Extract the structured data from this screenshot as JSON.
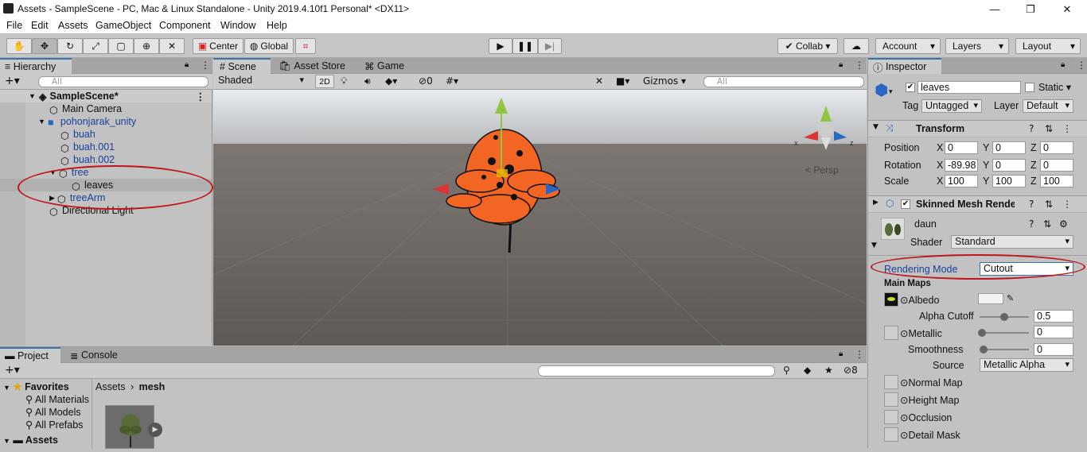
{
  "titlebar": {
    "title": "Assets - SampleScene - PC, Mac & Linux Standalone - Unity 2019.4.10f1 Personal* <DX11>",
    "minimize": "—",
    "maximize": "❐",
    "close": "✕"
  },
  "menu": [
    "File",
    "Edit",
    "Assets",
    "GameObject",
    "Component",
    "Window",
    "Help"
  ],
  "toolbar": {
    "center": "Center",
    "global": "Global",
    "collab": "Collab",
    "account": "Account",
    "layers": "Layers",
    "layout": "Layout"
  },
  "hierarchy": {
    "tab": "Hierarchy",
    "search_placeholder": "All",
    "scene": "SampleScene*",
    "items": [
      {
        "label": "Main Camera",
        "blue": false
      },
      {
        "label": "pohonjarak_unity",
        "blue": true
      },
      {
        "label": "buah",
        "blue": true
      },
      {
        "label": "buah.001",
        "blue": true
      },
      {
        "label": "buah.002",
        "blue": true
      },
      {
        "label": "tree",
        "blue": true
      },
      {
        "label": "leaves",
        "blue": false
      },
      {
        "label": "treeArm",
        "blue": true
      },
      {
        "label": "Directional Light",
        "blue": false
      }
    ]
  },
  "scene": {
    "tabs": [
      "Scene",
      "Asset Store",
      "Game"
    ],
    "shading": "Shaded",
    "mode2d": "2D",
    "fx_count": "0",
    "gizmos": "Gizmos",
    "search_placeholder": "All",
    "persp": "< Persp",
    "axis_x": "x",
    "axis_z": "z"
  },
  "project": {
    "tabs": [
      "Project",
      "Console"
    ],
    "favorites": "Favorites",
    "fav_items": [
      "All Materials",
      "All Models",
      "All Prefabs"
    ],
    "assets": "Assets",
    "breadcrumb": [
      "Assets",
      "mesh"
    ],
    "hidden_count": "8"
  },
  "inspector": {
    "tab": "Inspector",
    "object_name": "leaves",
    "static": "Static",
    "tag_label": "Tag",
    "tag": "Untagged",
    "layer_label": "Layer",
    "layer": "Default",
    "transform": {
      "title": "Transform",
      "position": {
        "label": "Position",
        "x": "0",
        "y": "0",
        "z": "0"
      },
      "rotation": {
        "label": "Rotation",
        "x": "-89.98",
        "y": "0",
        "z": "0"
      },
      "scale": {
        "label": "Scale",
        "x": "100",
        "y": "100",
        "z": "100"
      }
    },
    "smr_title": "Skinned Mesh Renderer",
    "material": {
      "name": "daun",
      "shader_label": "Shader",
      "shader": "Standard",
      "rendering_mode_label": "Rendering Mode",
      "rendering_mode": "Cutout",
      "main_maps": "Main Maps",
      "albedo": "Albedo",
      "alpha_cutoff_label": "Alpha Cutoff",
      "alpha_cutoff": "0.5",
      "metallic_label": "Metallic",
      "metallic": "0",
      "smoothness_label": "Smoothness",
      "smoothness": "0",
      "source_label": "Source",
      "source": "Metallic Alpha",
      "normal_map": "Normal Map",
      "height_map": "Height Map",
      "occlusion": "Occlusion",
      "detail_mask": "Detail Mask"
    }
  },
  "axis_labels": {
    "x": "X",
    "y": "Y",
    "z": "Z"
  },
  "colors": {
    "accent": "#3a72b0",
    "highlight": "#c0161b",
    "selection": "#f26522"
  }
}
